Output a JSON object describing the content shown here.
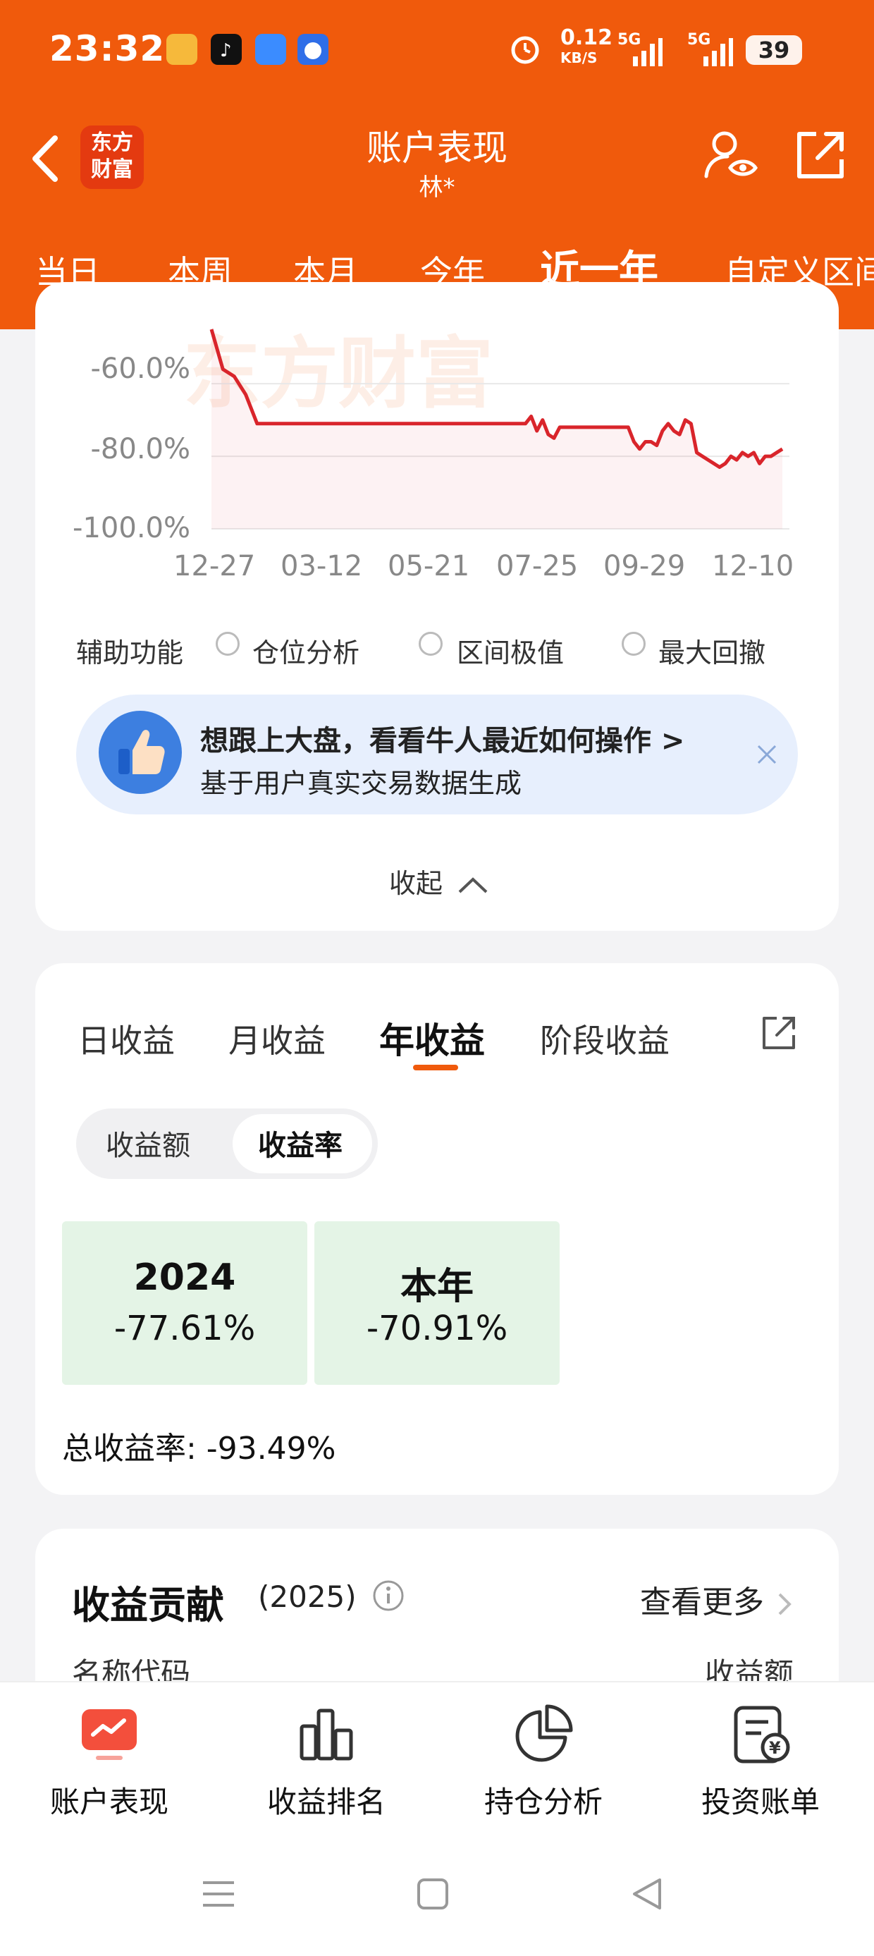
{
  "status_bar": {
    "time": "23:32",
    "net_speed_value": "0.12",
    "net_speed_unit": "KB/S",
    "signal1": "5G",
    "signal2": "5G",
    "battery": "39",
    "app_icons": [
      "video-app-icon",
      "tiktok-icon",
      "browser-app-icon",
      "baidu-icon"
    ]
  },
  "header": {
    "logo_line1": "东方",
    "logo_line2": "财富",
    "title": "账户表现",
    "subtitle": "林*",
    "icons": [
      "back-icon",
      "user-eye-icon",
      "share-icon"
    ]
  },
  "period_tabs": [
    {
      "label": "当日"
    },
    {
      "label": "本周"
    },
    {
      "label": "本月"
    },
    {
      "label": "今年"
    },
    {
      "label": "近一年",
      "active": true
    },
    {
      "label": "自定义区间"
    }
  ],
  "chart_data": {
    "type": "line",
    "x_ticks": [
      "12-27",
      "03-12",
      "05-21",
      "07-25",
      "09-29",
      "12-10"
    ],
    "y_ticks": [
      "-60.0%",
      "-80.0%",
      "-100.0%"
    ],
    "ylim": [
      -100,
      -45
    ],
    "series": [
      {
        "color": "#d9252b",
        "x": [
          0,
          2,
          4,
          6,
          8,
          10,
          30,
          40,
          50,
          55,
          56,
          57,
          58,
          59,
          60,
          61,
          62,
          63,
          64,
          70,
          73,
          74,
          75,
          76,
          77,
          78,
          79,
          80,
          81,
          82,
          83,
          84,
          85,
          86,
          87,
          88,
          89,
          90,
          91,
          92,
          93,
          94,
          95,
          96,
          97,
          98,
          99,
          100
        ],
        "y": [
          -45,
          -56,
          -58,
          -63,
          -71,
          -71,
          -71,
          -71,
          -71,
          -71,
          -69,
          -73,
          -70,
          -74,
          -75,
          -72,
          -72,
          -72,
          -72,
          -72,
          -72,
          -76,
          -78,
          -76,
          -76,
          -77,
          -73,
          -71,
          -73,
          -74,
          -70,
          -71,
          -79,
          -80,
          -81,
          -82,
          -83,
          -82,
          -80,
          -81,
          -79,
          -80,
          -79,
          -82,
          -80,
          -80,
          -79,
          -78
        ]
      }
    ]
  },
  "watermark": "东方财富",
  "aux": {
    "label": "辅助功能",
    "options": [
      "仓位分析",
      "区间极值",
      "最大回撤"
    ]
  },
  "banner": {
    "title": "想跟上大盘，看看牛人最近如何操作 >",
    "subtitle": "基于用户真实交易数据生成"
  },
  "collapse_label": "收起",
  "returns": {
    "tabs": [
      {
        "label": "日收益"
      },
      {
        "label": "月收益"
      },
      {
        "label": "年收益",
        "active": true
      },
      {
        "label": "阶段收益"
      }
    ],
    "segments": [
      "收益额",
      "收益率"
    ],
    "active_segment": "收益率",
    "years": [
      {
        "year": "2024",
        "value": "-77.61%"
      },
      {
        "year": "本年",
        "value": "-70.91%"
      }
    ],
    "total": "总收益率: -93.49%",
    "box_color": "#e4f4e6"
  },
  "contribution": {
    "title": "收益贡献",
    "year": "(2025)",
    "more": "查看更多",
    "col_name": "名称代码",
    "col_gain": "收益额"
  },
  "bottom_nav": [
    {
      "label": "账户表现",
      "icon": "account-performance-icon",
      "active": true
    },
    {
      "label": "收益排名",
      "icon": "bar-chart-icon"
    },
    {
      "label": "持仓分析",
      "icon": "pie-chart-icon"
    },
    {
      "label": "投资账单",
      "icon": "bill-icon"
    }
  ],
  "colors": {
    "brand": "#f05a0c",
    "line": "#d9252b"
  }
}
